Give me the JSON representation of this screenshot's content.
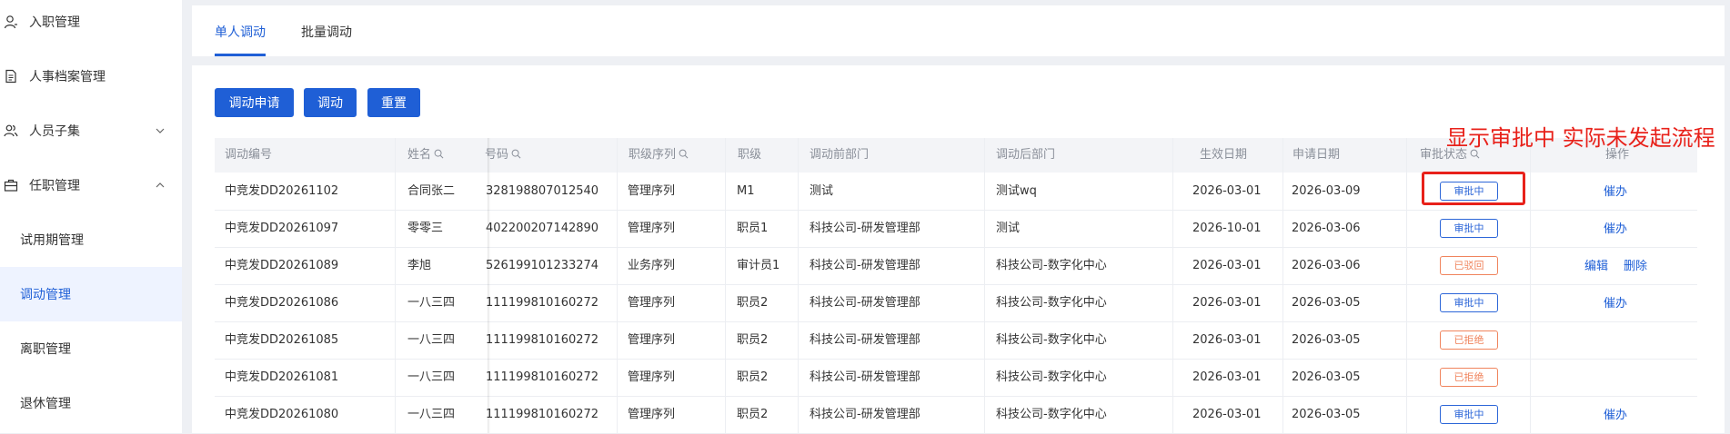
{
  "sidebar": {
    "items": [
      {
        "label": "入职管理",
        "icon": "user-icon"
      },
      {
        "label": "人事档案管理",
        "icon": "document-icon"
      },
      {
        "label": "人员子集",
        "icon": "users-icon",
        "chevron": "chevron-down-icon"
      },
      {
        "label": "任职管理",
        "icon": "briefcase-icon",
        "chevron": "chevron-up-icon"
      },
      {
        "label": "试用期管理"
      },
      {
        "label": "调动管理",
        "active": true
      },
      {
        "label": "离职管理"
      },
      {
        "label": "退休管理"
      }
    ]
  },
  "tabs": [
    {
      "label": "单人调动",
      "active": true
    },
    {
      "label": "批量调动"
    }
  ],
  "toolbar": {
    "apply_label": "调动申请",
    "transfer_label": "调动",
    "reset_label": "重置"
  },
  "table": {
    "headers": [
      "调动编号",
      "姓名",
      "号码",
      "职级序列",
      "职级",
      "调动前部门",
      "调动后部门",
      "生效日期",
      "申请日期",
      "审批状态",
      "操作"
    ],
    "rows": [
      {
        "code": "中竞发DD20261102",
        "name": "合同张二",
        "id": "328198807012540",
        "series": "管理序列",
        "level": "M1",
        "from": "测试",
        "to": "测试wq",
        "effective": "2026-03-01",
        "applied": "2026-03-09",
        "status": "审批中",
        "status_type": "blue",
        "actions": [
          "催办"
        ]
      },
      {
        "code": "中竞发DD20261097",
        "name": "零零三",
        "id": "402200207142890",
        "series": "管理序列",
        "level": "职员1",
        "from": "科技公司-研发管理部",
        "to": "测试",
        "effective": "2026-10-01",
        "applied": "2026-03-06",
        "status": "审批中",
        "status_type": "blue",
        "actions": [
          "催办"
        ]
      },
      {
        "code": "中竞发DD20261089",
        "name": "李旭",
        "id": "526199101233274",
        "series": "业务序列",
        "level": "审计员1",
        "from": "科技公司-研发管理部",
        "to": "科技公司-数字化中心",
        "effective": "2026-03-01",
        "applied": "2026-03-06",
        "status": "已驳回",
        "status_type": "red",
        "actions": [
          "编辑",
          "删除"
        ]
      },
      {
        "code": "中竞发DD20261086",
        "name": "一八三四",
        "id": "111199810160272",
        "series": "管理序列",
        "level": "职员2",
        "from": "科技公司-研发管理部",
        "to": "科技公司-数字化中心",
        "effective": "2026-03-01",
        "applied": "2026-03-05",
        "status": "审批中",
        "status_type": "blue",
        "actions": [
          "催办"
        ]
      },
      {
        "code": "中竞发DD20261085",
        "name": "一八三四",
        "id": "111199810160272",
        "series": "管理序列",
        "level": "职员2",
        "from": "科技公司-研发管理部",
        "to": "科技公司-数字化中心",
        "effective": "2026-03-01",
        "applied": "2026-03-05",
        "status": "已拒绝",
        "status_type": "red",
        "actions": []
      },
      {
        "code": "中竞发DD20261081",
        "name": "一八三四",
        "id": "111199810160272",
        "series": "管理序列",
        "level": "职员2",
        "from": "科技公司-研发管理部",
        "to": "科技公司-数字化中心",
        "effective": "2026-03-01",
        "applied": "2026-03-05",
        "status": "已拒绝",
        "status_type": "red",
        "actions": []
      },
      {
        "code": "中竞发DD20261080",
        "name": "一八三四",
        "id": "111199810160272",
        "series": "管理序列",
        "level": "职员2",
        "from": "科技公司-研发管理部",
        "to": "科技公司-数字化中心",
        "effective": "2026-03-01",
        "applied": "2026-03-05",
        "status": "审批中",
        "status_type": "blue",
        "actions": [
          "催办"
        ]
      }
    ]
  },
  "annotation": {
    "text": "显示审批中 实际未发起流程",
    "color": "#e8211a"
  },
  "colors": {
    "primary": "#1f5fd6",
    "status_blue": "#2c66d8",
    "status_red": "#f0845d"
  }
}
